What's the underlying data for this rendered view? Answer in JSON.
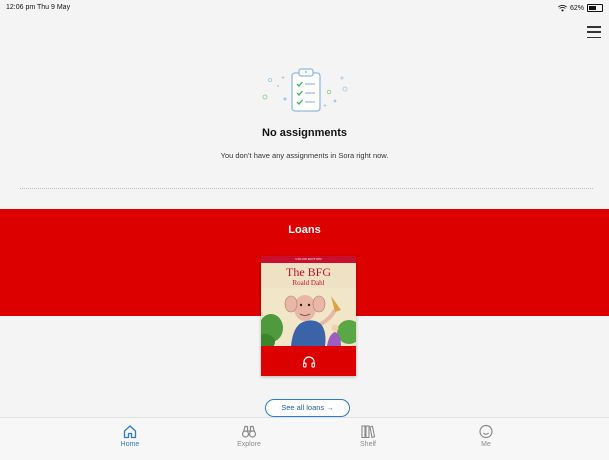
{
  "status_bar": {
    "time": "12:06 pm  Thu 9 May",
    "battery_percent": "62%",
    "battery_level": 0.62
  },
  "assignments": {
    "title": "No assignments",
    "description": "You don’t have any assignments in Sora right now."
  },
  "loans": {
    "title": "Loans",
    "book": {
      "banner": "COLOR EDITION",
      "title": "The BFG",
      "author": "Roald Dahl",
      "format_icon": "headphones-icon"
    },
    "see_all_label": "See all loans →"
  },
  "tab_bar": {
    "tabs": [
      {
        "label": "Home",
        "icon": "home-icon",
        "active": true
      },
      {
        "label": "Explore",
        "icon": "binoculars-icon",
        "active": false
      },
      {
        "label": "Shelf",
        "icon": "books-icon",
        "active": false
      },
      {
        "label": "Me",
        "icon": "smiley-icon",
        "active": false
      }
    ]
  },
  "colors": {
    "accent_red": "#dc0000",
    "link_blue": "#2c7bd0",
    "background": "#f4f4f4"
  }
}
